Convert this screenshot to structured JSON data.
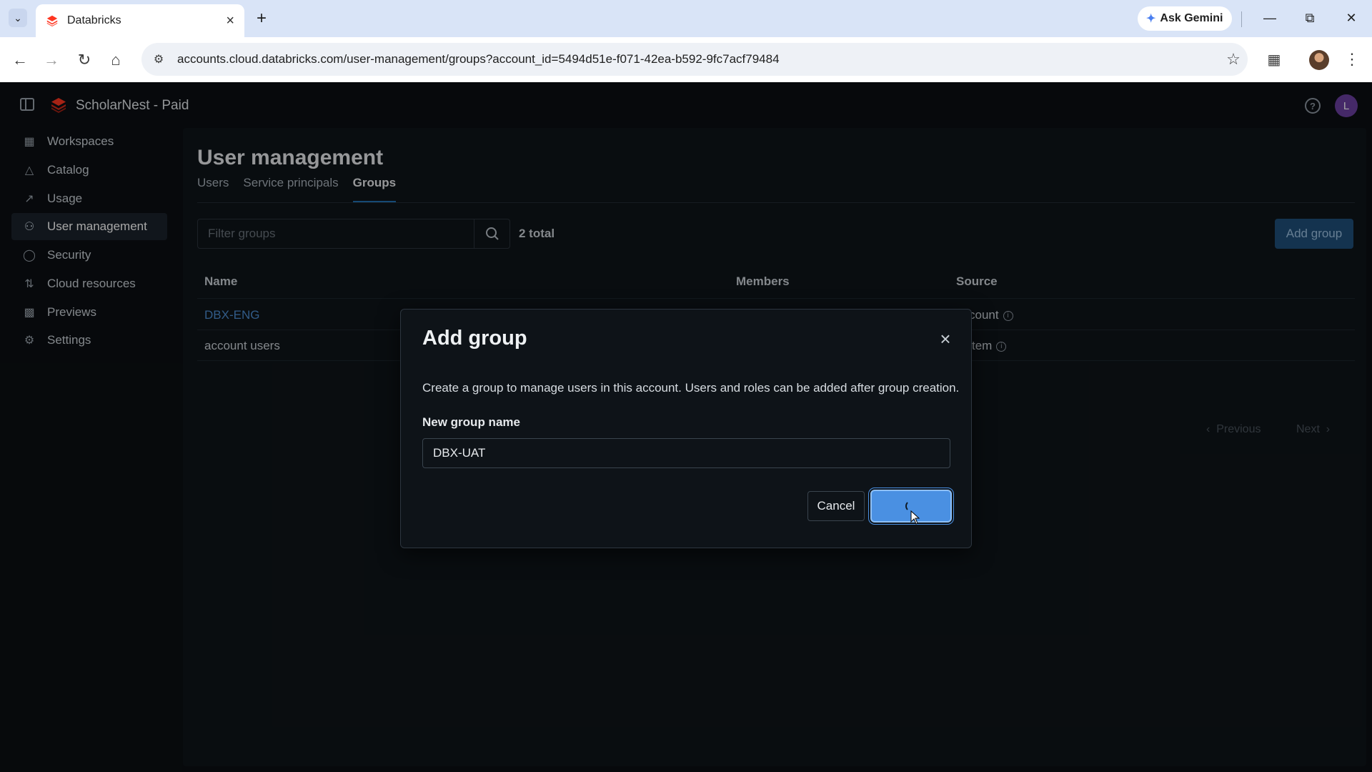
{
  "browser": {
    "tab_title": "Databricks",
    "gemini_label": "Ask Gemini",
    "url": "accounts.cloud.databricks.com/user-management/groups?account_id=5494d51e-f071-42ea-b592-9fc7acf79484"
  },
  "app": {
    "workspace_name": "ScholarNest - Paid",
    "user_initial": "L",
    "brand_color": "#ff3621"
  },
  "sidebar": {
    "items": [
      {
        "label": "Workspaces",
        "icon": "workspaces-icon"
      },
      {
        "label": "Catalog",
        "icon": "catalog-icon"
      },
      {
        "label": "Usage",
        "icon": "usage-icon"
      },
      {
        "label": "User management",
        "icon": "users-icon",
        "active": true
      },
      {
        "label": "Security",
        "icon": "shield-icon"
      },
      {
        "label": "Cloud resources",
        "icon": "cloud-resources-icon"
      },
      {
        "label": "Previews",
        "icon": "gift-icon"
      },
      {
        "label": "Settings",
        "icon": "gear-icon"
      }
    ]
  },
  "page": {
    "title": "User management",
    "tabs": [
      "Users",
      "Service principals",
      "Groups"
    ],
    "active_tab": "Groups",
    "filter_placeholder": "Filter groups",
    "total": "2 total",
    "add_group_label": "Add group",
    "columns": {
      "name": "Name",
      "members": "Members",
      "source": "Source"
    },
    "rows": [
      {
        "name": "DBX-ENG",
        "source_visible": "count"
      },
      {
        "name": "account users",
        "source_visible": "tem"
      }
    ],
    "pager": {
      "previous": "Previous",
      "next": "Next"
    }
  },
  "modal": {
    "title": "Add group",
    "description": "Create a group to manage users in this account. Users and roles can be added after group creation.",
    "field_label": "New group name",
    "field_value": "DBX-UAT",
    "cancel_label": "Cancel",
    "create_state": "loading",
    "accent": "#4a90e2"
  }
}
